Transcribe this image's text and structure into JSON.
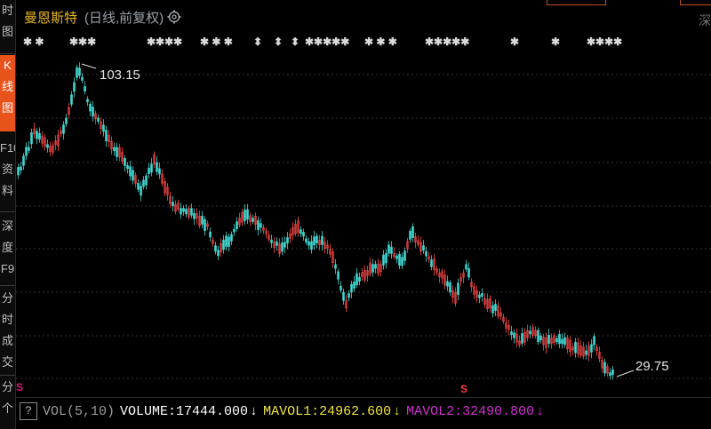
{
  "title": {
    "stock_name": "曼恩斯特",
    "mode": "(日线,前复权)"
  },
  "sidebar": {
    "items": [
      {
        "label": "时\n图",
        "active": false
      },
      {
        "label": "K\n线\n图",
        "active": true
      },
      {
        "label": "F10\n资\n料",
        "active": false
      },
      {
        "label": "深\n度\nF9",
        "active": false
      },
      {
        "label": "分\n时\n成\n交",
        "active": false
      },
      {
        "label": "分\n个",
        "active": false
      }
    ]
  },
  "corner_text": "深",
  "chart_data": {
    "type": "candlestick",
    "high_label": "103.15",
    "low_label": "29.75",
    "colors": {
      "up": "#ff4a4a",
      "down": "#3fd7d0",
      "grid": "#3a2e2e",
      "background": "#000000"
    }
  },
  "volume_bar": {
    "help": "?",
    "vol_label": "VOL(5,10)",
    "volume": "VOLUME:17444.000",
    "mavol1": "MAVOL1:24962.600",
    "mavol2": "MAVOL2:32490.800",
    "arrow": "↓",
    "colors": {
      "vol_label": "#9b9b9b",
      "volume": "#ffffff",
      "mavol1": "#f0e43a",
      "mavol2": "#d12fd1"
    }
  },
  "markers": {
    "s_label": "S"
  }
}
